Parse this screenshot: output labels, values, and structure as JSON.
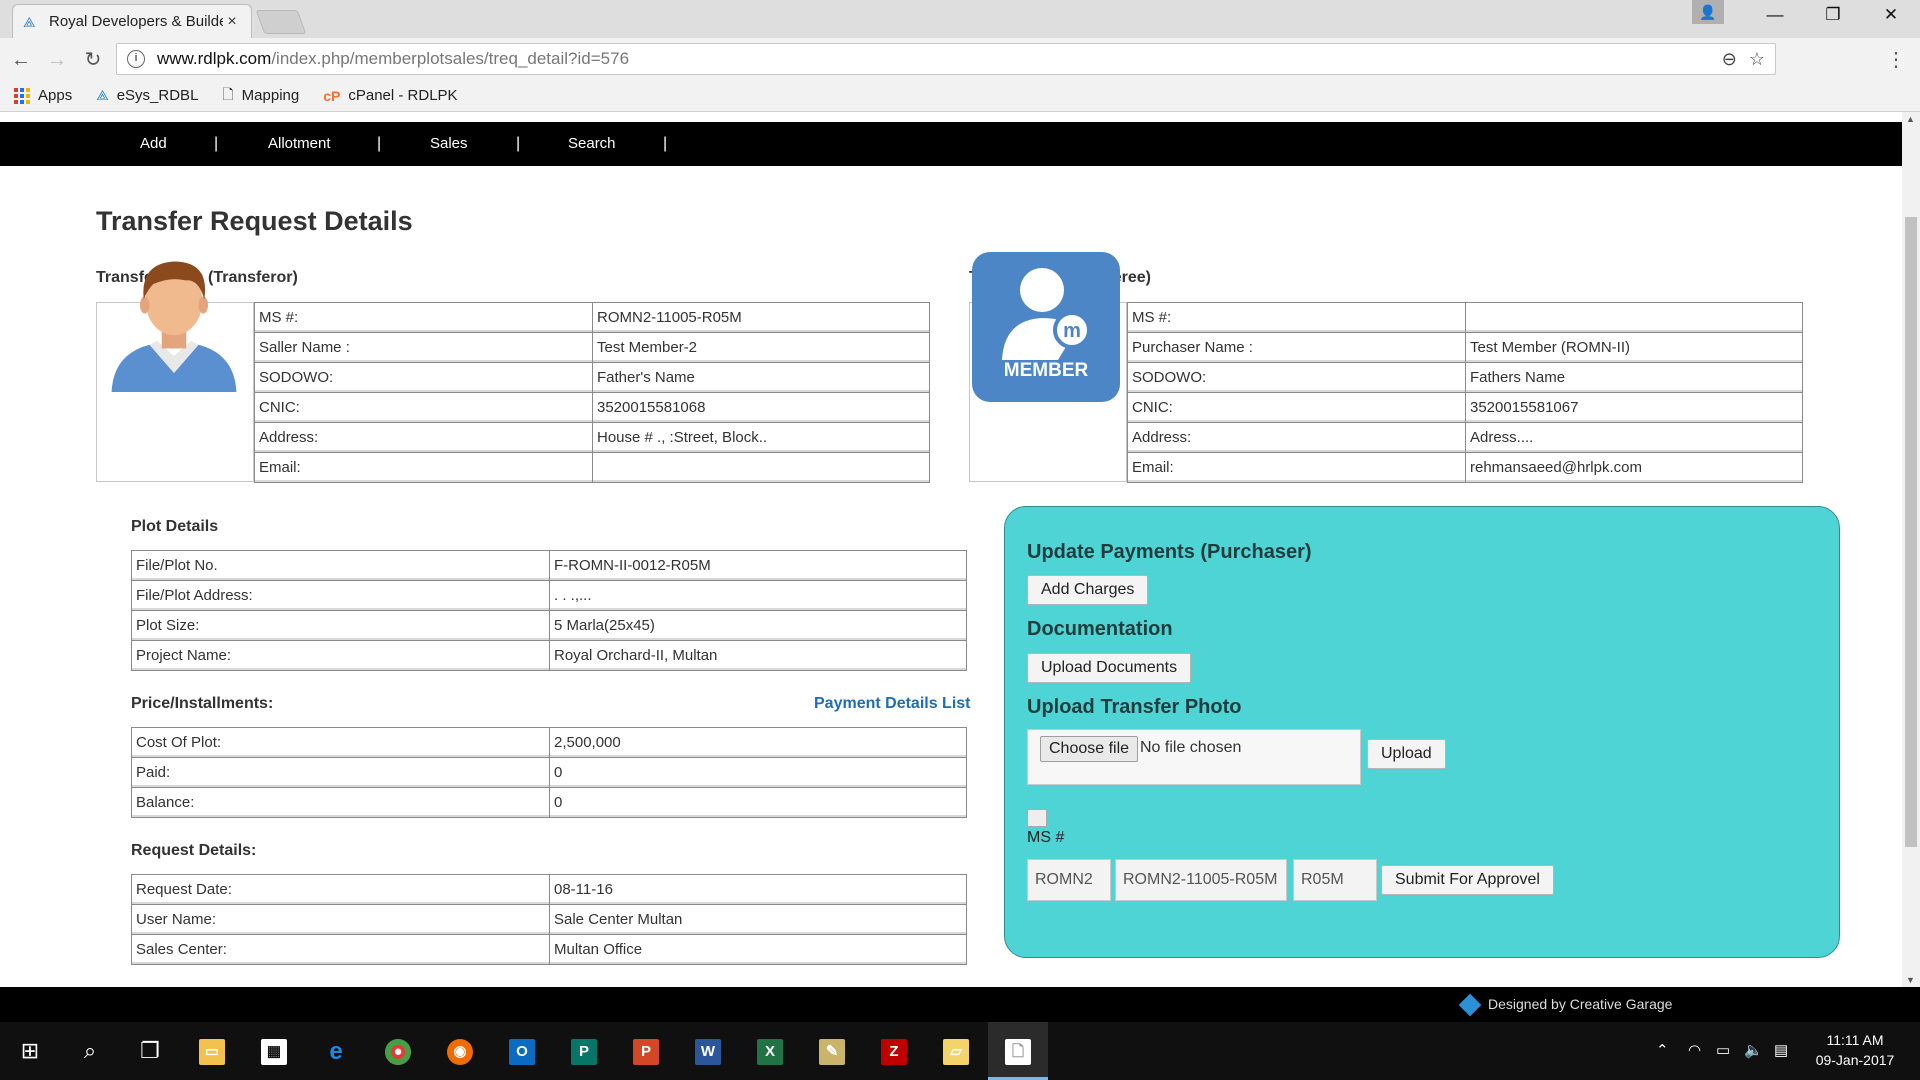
{
  "browser": {
    "tab_title": "Royal Developers & Builde",
    "close_glyph": "×",
    "url_host": "www.rdlpk.com",
    "url_path": "/index.php/memberplotsales/treq_detail?id=576",
    "bookmarks": [
      {
        "label": "Apps",
        "icon": "apps-grid-icon"
      },
      {
        "label": "eSys_RDBL",
        "icon": "rdl-logo-icon"
      },
      {
        "label": "Mapping",
        "icon": "page-icon"
      },
      {
        "label": "cPanel - RDLPK",
        "icon": "cpanel-icon"
      }
    ]
  },
  "nav": {
    "items": [
      "Add",
      "Allotment",
      "Sales",
      "Search"
    ],
    "separator": "|"
  },
  "page": {
    "title": "Transfer Request Details"
  },
  "transferor": {
    "heading": "Transfer From (Transferor)",
    "rows": [
      {
        "label": "MS #:",
        "value": "ROMN2-11005-R05M"
      },
      {
        "label": "Saller Name :",
        "value": "Test Member-2"
      },
      {
        "label": "SODOWO:",
        "value": "Father's Name"
      },
      {
        "label": "CNIC:",
        "value": "3520015581068"
      },
      {
        "label": "Address:",
        "value": "House # ., :Street, Block.."
      },
      {
        "label": "Email:",
        "value": ""
      }
    ]
  },
  "transferee": {
    "heading": "Transfer To (Transferee)",
    "member_badge": "MEMBER",
    "rows": [
      {
        "label": "MS #:",
        "value": ""
      },
      {
        "label": "Purchaser Name :",
        "value": "Test Member (ROMN-II)"
      },
      {
        "label": "SODOWO:",
        "value": "Fathers Name"
      },
      {
        "label": "CNIC:",
        "value": "3520015581067"
      },
      {
        "label": "Address:",
        "value": "Adress...."
      },
      {
        "label": "Email:",
        "value": "rehmansaeed@hrlpk.com"
      }
    ]
  },
  "plot": {
    "heading": "Plot Details",
    "rows": [
      {
        "label": "File/Plot No.",
        "value": "F-ROMN-II-0012-R05M"
      },
      {
        "label": "File/Plot Address:",
        "value": ". . .,..."
      },
      {
        "label": "Plot Size:",
        "value": "5 Marla(25x45)"
      },
      {
        "label": "Project Name:",
        "value": "Royal Orchard-II, Multan"
      }
    ]
  },
  "price": {
    "heading": "Price/Installments:",
    "link": "Payment Details List",
    "rows": [
      {
        "label": "Cost Of Plot:",
        "value": "2,500,000"
      },
      {
        "label": "Paid:",
        "value": "0"
      },
      {
        "label": "Balance:",
        "value": "0"
      }
    ]
  },
  "request": {
    "heading": "Request Details:",
    "rows": [
      {
        "label": "Request Date:",
        "value": "08-11-16"
      },
      {
        "label": "User Name:",
        "value": "Sale Center Multan"
      },
      {
        "label": "Sales Center:",
        "value": "Multan Office"
      }
    ]
  },
  "panel": {
    "update_heading": "Update Payments (Purchaser)",
    "add_charges": "Add Charges",
    "doc_heading": "Documentation",
    "upload_docs": "Upload Documents",
    "photo_heading": "Upload Transfer Photo",
    "choose_file": "Choose file",
    "no_file": "No file chosen",
    "upload": "Upload",
    "ms_label": "MS #",
    "ms_parts": [
      "ROMN2",
      "ROMN2-11005-R05M",
      "R05M"
    ],
    "submit": "Submit For Approvel"
  },
  "footer": {
    "credit": "Designed by Creative Garage"
  },
  "taskbar": {
    "time": "11:11 AM",
    "date": "09-Jan-2017"
  },
  "colors": {
    "panel_bg": "#4fd4d6",
    "nav_bg": "#000000",
    "link": "#1f6db8",
    "member_badge": "#4c86c6"
  }
}
